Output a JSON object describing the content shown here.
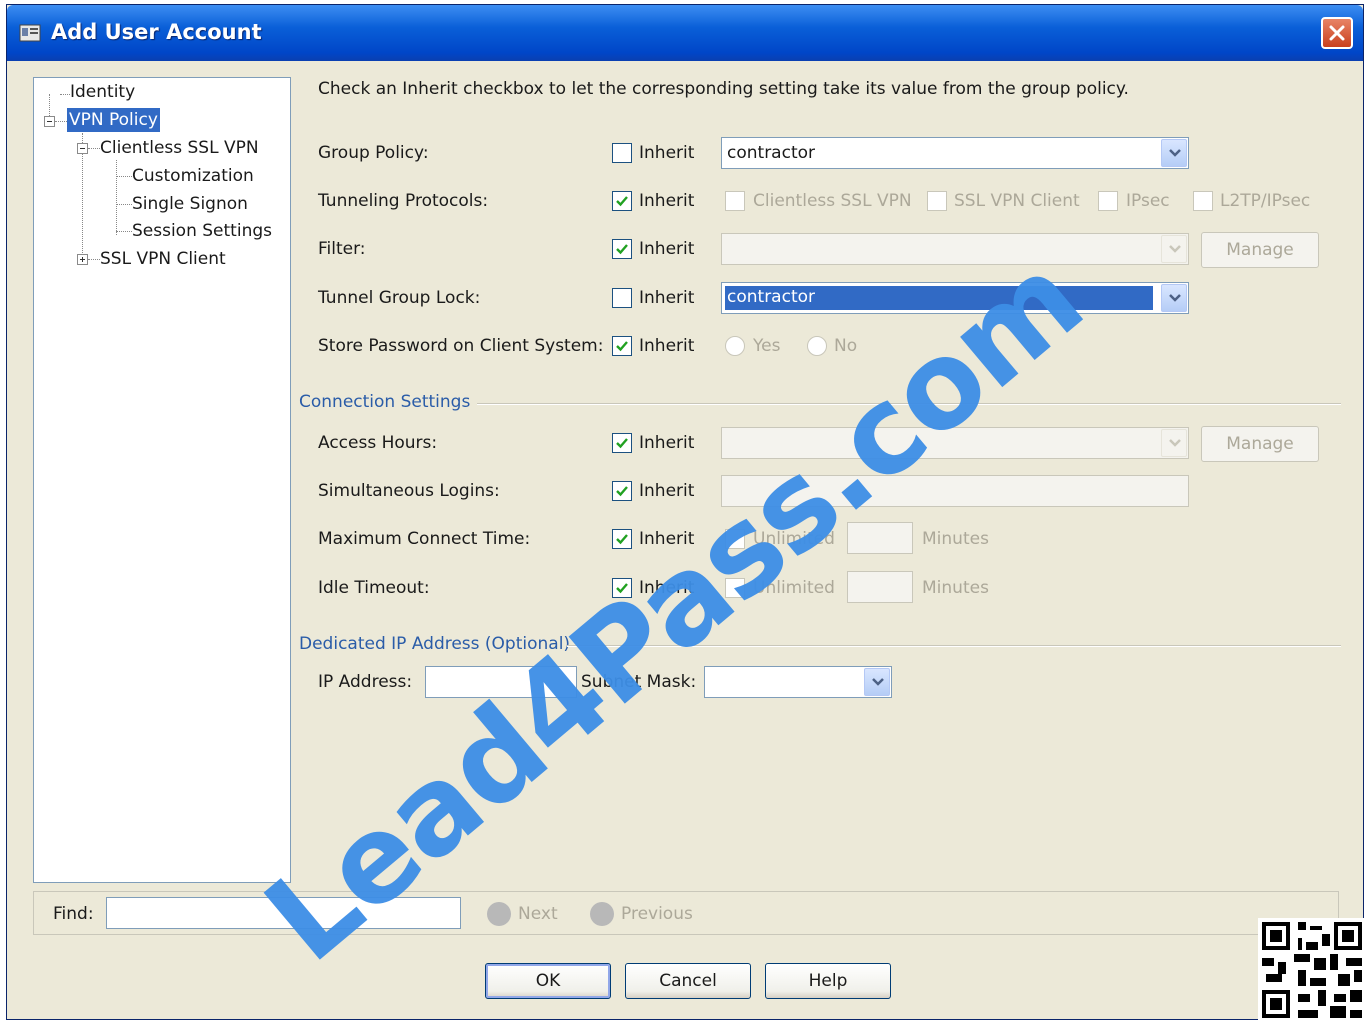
{
  "window": {
    "title": "Add User Account"
  },
  "tree": {
    "items": [
      {
        "label": "Identity"
      },
      {
        "label": "VPN Policy"
      },
      {
        "label": "Clientless SSL VPN"
      },
      {
        "label": "Customization"
      },
      {
        "label": "Single Signon"
      },
      {
        "label": "Session Settings"
      },
      {
        "label": "SSL VPN Client"
      }
    ]
  },
  "main": {
    "instruction": "Check an Inherit checkbox to let the corresponding setting take its value from the group policy.",
    "inherit_label": "Inherit",
    "rows": {
      "group_policy": {
        "label": "Group Policy:",
        "inherit": false,
        "value": "contractor"
      },
      "tunneling_protocols": {
        "label": "Tunneling Protocols:",
        "inherit": true,
        "options": [
          "Clientless SSL VPN",
          "SSL VPN Client",
          "IPsec",
          "L2TP/IPsec"
        ]
      },
      "filter": {
        "label": "Filter:",
        "inherit": true,
        "value": "",
        "manage_label": "Manage"
      },
      "tunnel_group_lock": {
        "label": "Tunnel Group Lock:",
        "inherit": false,
        "value": "contractor"
      },
      "store_password": {
        "label": "Store Password on Client System:",
        "inherit": true,
        "yes_label": "Yes",
        "no_label": "No"
      }
    },
    "connection_settings": {
      "title": "Connection Settings",
      "access_hours": {
        "label": "Access Hours:",
        "inherit": true,
        "value": "",
        "manage_label": "Manage"
      },
      "simultaneous_logins": {
        "label": "Simultaneous Logins:",
        "inherit": true,
        "value": ""
      },
      "max_connect_time": {
        "label": "Maximum Connect Time:",
        "inherit": true,
        "unlimited_label": "Unlimited",
        "minutes_label": "Minutes",
        "value": ""
      },
      "idle_timeout": {
        "label": "Idle Timeout:",
        "inherit": true,
        "unlimited_label": "Unlimited",
        "minutes_label": "Minutes",
        "value": ""
      }
    },
    "dedicated_ip": {
      "title": "Dedicated IP Address (Optional)",
      "ip_label": "IP Address:",
      "ip_value": "",
      "subnet_label": "Subnet Mask:",
      "subnet_value": ""
    }
  },
  "find": {
    "label": "Find:",
    "value": "",
    "next_label": "Next",
    "previous_label": "Previous"
  },
  "buttons": {
    "ok": "OK",
    "cancel": "Cancel",
    "help": "Help"
  },
  "watermark": {
    "text": "Lead4Pass.com",
    "color": "#3d8ee6"
  },
  "colors": {
    "title_bar": "#0a5fd8",
    "selection": "#316ac5",
    "section_title": "#2a5ca8",
    "dialog_bg": "#ece9d8"
  }
}
